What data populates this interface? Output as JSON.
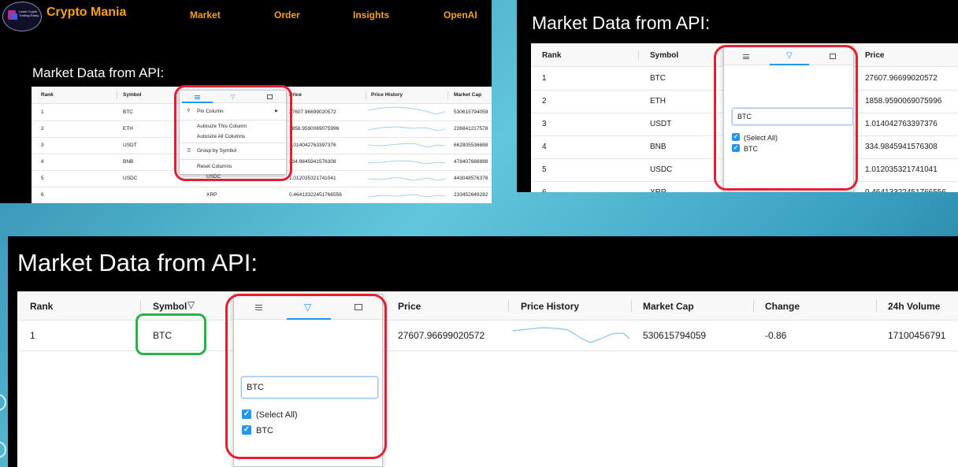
{
  "app": {
    "name": "Crypto Mania",
    "logo_tagline": "Learn Crypto Trading Easily",
    "nav": [
      "Market",
      "Order",
      "Insights",
      "OpenAI"
    ]
  },
  "title": "Market Data from API:",
  "columns": [
    "Rank",
    "Symbol",
    "Price",
    "Price History",
    "Market Cap",
    "Change",
    "24h Volume"
  ],
  "rows": [
    {
      "rank": "1",
      "symbol": "BTC",
      "price": "27607.96699020572",
      "market_cap": "530615794059",
      "change": "-0.86",
      "volume": "17100456791"
    },
    {
      "rank": "2",
      "symbol": "ETH",
      "price": "1858.9590069075996",
      "market_cap": "226841217578"
    },
    {
      "rank": "3",
      "symbol": "USDT",
      "price": "1.014042763397376",
      "market_cap": "662805536688"
    },
    {
      "rank": "4",
      "symbol": "BNB",
      "price": "334.9845941576308",
      "market_cap": "478407688888"
    },
    {
      "rank": "5",
      "symbol": "USDC",
      "price": "1.012035321741041",
      "market_cap": "443048576378"
    },
    {
      "rank": "6",
      "symbol": "XRP",
      "price": "0.46413322451766556",
      "market_cap": "233452649282"
    }
  ],
  "column_menu": {
    "items": [
      "Pin Column",
      "Autosize This Column",
      "Autosize All Columns",
      "Group by Symbol",
      "Reset Columns"
    ],
    "behind_text": "USDC"
  },
  "filter": {
    "value": "BTC",
    "options": [
      "(Select All)",
      "BTC"
    ]
  },
  "icons": {
    "menu_tab": "hamburger-icon",
    "filter_tab": "funnel-icon",
    "columns_tab": "columns-icon",
    "pin": "pin-icon",
    "group": "group-icon",
    "submenu": "triangle-right-icon"
  },
  "colors": {
    "brand_orange": "#f4a11d",
    "highlight_red": "#e42030",
    "highlight_green": "#27b34a",
    "accent_blue": "#2196f3",
    "sparkline": "#8cc3ea"
  }
}
